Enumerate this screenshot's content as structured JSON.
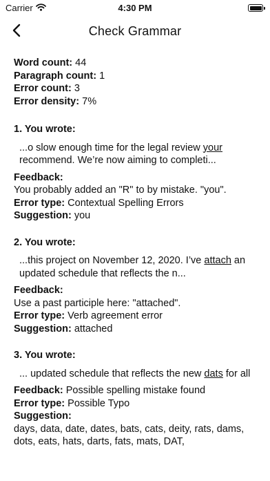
{
  "status_bar": {
    "carrier": "Carrier",
    "time": "4:30 PM",
    "battery_level": 1.0
  },
  "nav": {
    "title": "Check Grammar"
  },
  "stats": {
    "word_count_label": "Word count:",
    "word_count": "44",
    "paragraph_count_label": "Paragraph count:",
    "paragraph_count": "1",
    "error_count_label": "Error count:",
    "error_count": "3",
    "error_density_label": "Error density:",
    "error_density": "7%"
  },
  "labels": {
    "feedback": "Feedback:",
    "error_type": "Error type:",
    "suggestion": "Suggestion:"
  },
  "errors": [
    {
      "title": "1. You wrote:",
      "before": "...o slow enough time for the legal review ",
      "word": "your",
      "after": " recommend. We’re now aiming to completi...",
      "feedback": "You probably added an \"R\" to by mistake. \"you\".",
      "error_type": "Contextual Spelling Errors",
      "suggestion": "you"
    },
    {
      "title": "2. You wrote:",
      "before": "...this project on November 12, 2020. I’ve ",
      "word": "attach",
      "after": " an updated schedule that reflects the n...",
      "feedback": "Use a past participle here: \"attached\".",
      "error_type": "Verb agreement error",
      "suggestion": "attached"
    },
    {
      "title": "3. You wrote:",
      "before": "... updated schedule that reflects the new ",
      "word": "dats",
      "after": " for all",
      "feedback": "Possible spelling mistake found",
      "error_type": "Possible Typo",
      "suggestion": "days, data, date, dates, bats, cats, deity, rats, dams, dots, eats, hats, darts, fats, mats, DAT,"
    }
  ]
}
